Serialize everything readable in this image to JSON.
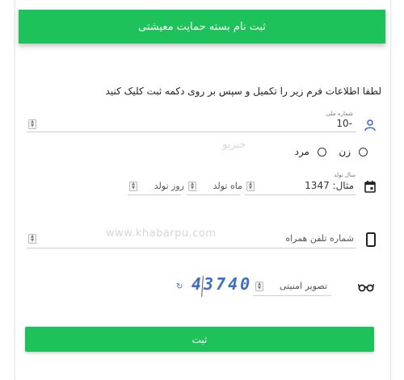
{
  "header": {
    "title": "ثبت نام بسته حمایت معیشتی"
  },
  "instruction": "لطفا اطلاعات فرم زیر را تکمیل و سپس بر روی دکمه ثبت کلیک کنید",
  "national_id": {
    "label": "شماره ملی",
    "value": "-10"
  },
  "gender": {
    "female_label": "زن",
    "male_label": "مرد"
  },
  "birth": {
    "year_label": "سال تولد",
    "year_value": "مثال: 1347",
    "month_placeholder": "ماه تولد",
    "day_placeholder": "روز تولد"
  },
  "phone": {
    "placeholder": "شماره تلفن همراه"
  },
  "security": {
    "placeholder": "تصویر امنیتی",
    "captcha_text": "43740"
  },
  "watermarks": {
    "logo_text": "خبرپو",
    "site_text": "www.khabarpu.com"
  },
  "submit": {
    "label": "ثبت"
  },
  "icons": {
    "person": "person-icon",
    "calendar": "calendar-icon",
    "phone": "phone-icon",
    "glasses": "glasses-icon",
    "refresh": "refresh-icon"
  },
  "colors": {
    "accent": "#1ec25a",
    "icon_blue": "#3b6fc4"
  }
}
